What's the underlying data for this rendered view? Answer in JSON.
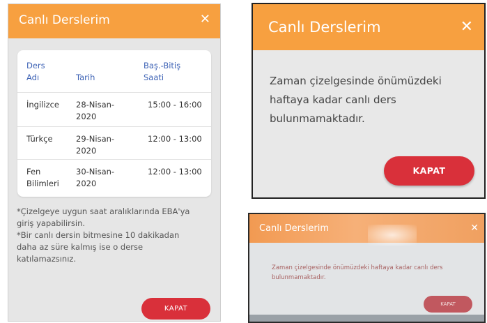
{
  "panel1": {
    "title": "Canlı Derslerim",
    "close": "✕",
    "table": {
      "headers": {
        "ders_line1": "Ders",
        "ders_line2": "Adı",
        "tarih": "Tarih",
        "saat_line1": "Baş.-Bitiş",
        "saat_line2": "Saati"
      },
      "rows": [
        {
          "ders_line1": "İngilizce",
          "ders_line2": "",
          "tarih_line1": "28-Nisan-",
          "tarih_line2": "2020",
          "saat": "15:00 - 16:00"
        },
        {
          "ders_line1": "Türkçe",
          "ders_line2": "",
          "tarih_line1": "29-Nisan-",
          "tarih_line2": "2020",
          "saat": "12:00 - 13:00"
        },
        {
          "ders_line1": "Fen",
          "ders_line2": "Bilimleri",
          "tarih_line1": "30-Nisan-",
          "tarih_line2": "2020",
          "saat": "12:00 - 13:00"
        }
      ]
    },
    "note1_line1": "*Çizelgeye uygun saat aralıklarında EBA'ya",
    "note1_line2": "giriş yapabilirsin.",
    "note2_line1": "*Bir canlı dersin bitmesine 10 dakikadan",
    "note2_line2": "daha az süre kalmış ise o derse",
    "note2_line3": "katılamazsınız.",
    "button": "KAPAT"
  },
  "panel2": {
    "title": "Canlı Derslerim",
    "close": "✕",
    "message_line1": "Zaman çizelgesinde önümüzdeki",
    "message_line2": "haftaya kadar canlı ders",
    "message_line3": "bulunmamaktadır.",
    "button": "KAPAT"
  },
  "panel3": {
    "title": "Canlı Derslerim",
    "close": "✕",
    "message_line1": "Zaman çizelgesinde önümüzdeki haftaya kadar canlı ders",
    "message_line2": "bulunmamaktadır.",
    "button": "KAPAT"
  },
  "colors": {
    "header_orange": "#f7a040",
    "button_red": "#d9303a",
    "table_header_blue": "#3d62b5"
  }
}
